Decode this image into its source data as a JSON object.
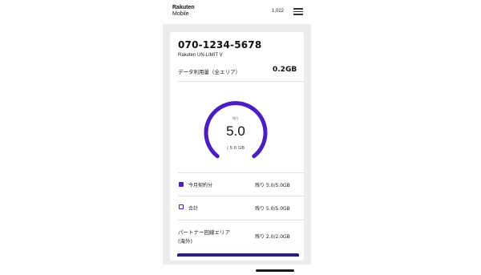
{
  "header": {
    "logo_line1": "Rakuten",
    "logo_line2": "Mobile",
    "points": "1,022",
    "menu_icon": "hamburger-menu-icon"
  },
  "account": {
    "phone_number": "070-1234-5678",
    "plan_name": "Rakuten UN-LIMIT V"
  },
  "usage": {
    "label": "データ利用量（全エリア）",
    "value": "0.2GB"
  },
  "gauge": {
    "caption": "残り",
    "remaining": "5.0",
    "total": "/ 5.0 GB",
    "fraction_remaining": 1.0,
    "arc_color": "#4b1fbf",
    "track_color": "#e6e3ef"
  },
  "breakdown": [
    {
      "label": "今月契約分",
      "value": "残り 5.0/5.0GB",
      "style": "filled"
    },
    {
      "label": "合計",
      "value": "残り 5.0/5.0GB",
      "style": "outline"
    }
  ],
  "partner": {
    "label_line1": "パートナー回線エリア",
    "label_line2": "(海外)",
    "value": "残り 2.0/2.0GB"
  },
  "colors": {
    "accent": "#4b1fbf",
    "cta": "#2e1f7a",
    "background": "#ececef"
  }
}
